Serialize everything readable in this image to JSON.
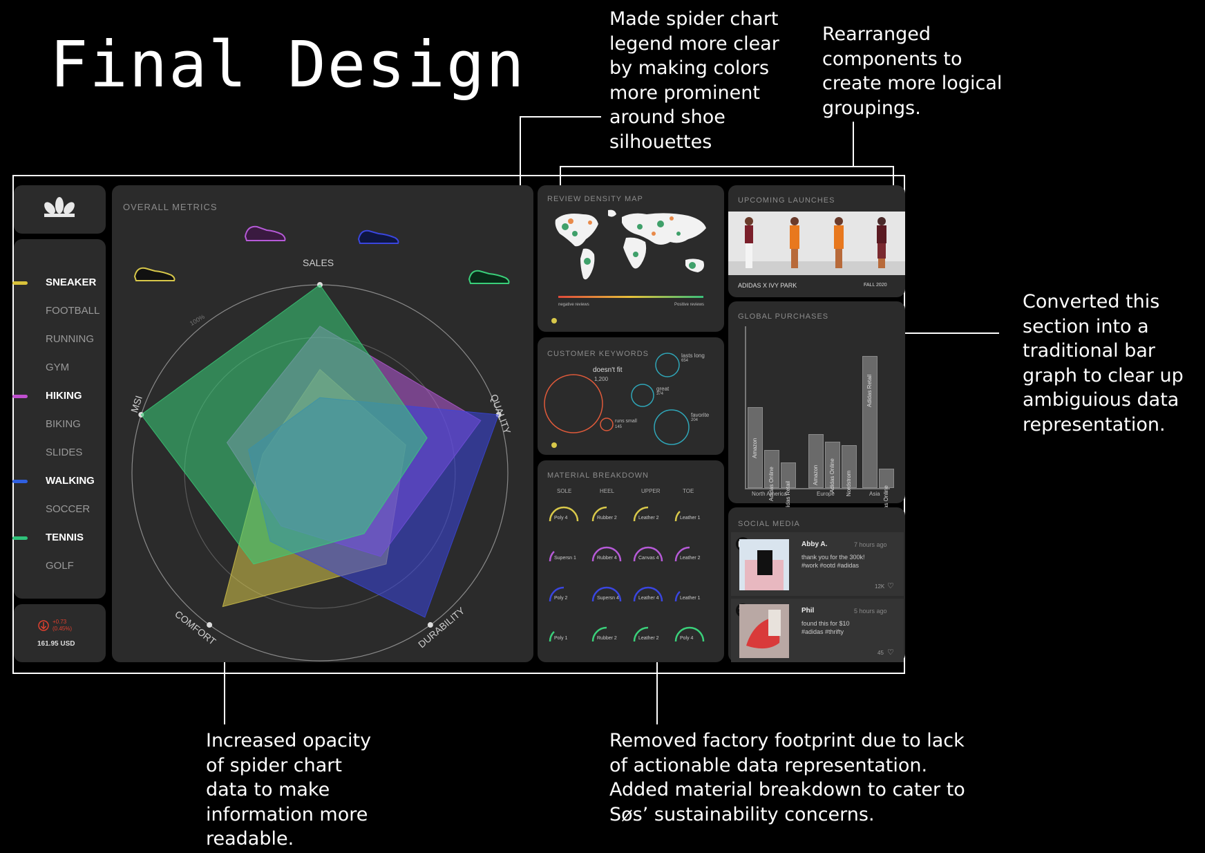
{
  "slide": {
    "title": "Final Design",
    "notes": {
      "spider_legend": "Made spider chart\nlegend more clear\nby making colors\nmore prominent\naround shoe\nsilhouettes",
      "rearranged": "Rearranged\ncomponents to\ncreate more logical\ngroupings.",
      "converted": "Converted this\nsection into a\ntraditional bar\ngraph to clear up\nambiguious data\nrepresentation.",
      "opacity": "Increased opacity\nof spider chart\ndata to make\ninformation more\nreadable.",
      "removed": "Removed factory footprint due to lack\nof actionable data representation.\nAdded material breakdown to cater to\nSøs’ sustainability concerns."
    }
  },
  "dashboard": {
    "logo_icon": "adidas-trefoil-icon",
    "sidebar": {
      "items": [
        {
          "label": "SNEAKER",
          "active": true,
          "color": "#d9c23a"
        },
        {
          "label": "FOOTBALL",
          "active": false
        },
        {
          "label": "RUNNING",
          "active": false
        },
        {
          "label": "GYM",
          "active": false
        },
        {
          "label": "HIKING",
          "active": true,
          "color": "#c04fd0"
        },
        {
          "label": "BIKING",
          "active": false
        },
        {
          "label": "SLIDES",
          "active": false
        },
        {
          "label": "WALKING",
          "active": true,
          "color": "#2f5fe0"
        },
        {
          "label": "SOCCER",
          "active": false
        },
        {
          "label": "TENNIS",
          "active": true,
          "color": "#2fc27a"
        },
        {
          "label": "GOLF",
          "active": false
        }
      ]
    },
    "stock": {
      "change": "+0.73",
      "percent": "(0.45%)",
      "price": "161.95 USD",
      "color": "#e0402f"
    },
    "overall_metrics": {
      "title": "OVERALL METRICS",
      "ring_label": "100%",
      "axes": [
        "SALES",
        "QUALITY",
        "DURABILITY",
        "COMFORT",
        "MSI"
      ]
    },
    "review_density": {
      "title": "REVIEW DENSITY MAP",
      "legend_left": "negative reviews",
      "legend_right": "Positive reviews"
    },
    "customer_keywords": {
      "title": "CUSTOMER KEYWORDS",
      "keywords": [
        {
          "label": "doesn't fit",
          "count": "1,200",
          "color": "#e05a3a"
        },
        {
          "label": "lasts long",
          "count": "654",
          "color": "#2fa6b8"
        },
        {
          "label": "great",
          "count": "374",
          "color": "#2fa6b8"
        },
        {
          "label": "runs small",
          "count": "145",
          "color": "#e05a3a"
        },
        {
          "label": "favorite",
          "count": "204",
          "color": "#2fa6b8"
        }
      ]
    },
    "material_breakdown": {
      "title": "MATERIAL BREAKDOWN",
      "columns": [
        "SOLE",
        "HEEL",
        "UPPER",
        "TOE"
      ],
      "rows": [
        [
          "Poly 4",
          "Rubber 2",
          "Leather 2",
          "Leather 1"
        ],
        [
          "Supersn 1",
          "Rubber 4",
          "Canvas 4",
          "Leather 2"
        ],
        [
          "Poly 2",
          "Supersn 4",
          "Leather 4",
          "Leather 1"
        ],
        [
          "Poly 1",
          "Rubber 2",
          "Leather 2",
          "Poly 4"
        ]
      ]
    },
    "upcoming_launches": {
      "title": "UPCOMING LAUNCHES",
      "caption": "ADIDAS X IVY PARK",
      "season": "FALL 2020"
    },
    "global_purchases": {
      "title": "GLOBAL PURCHASES"
    },
    "social_media": {
      "title": "SOCIAL MEDIA",
      "posts": [
        {
          "icon": "instagram-icon",
          "user": "Abby A.",
          "time": "7 hours ago",
          "text": "thank you for the 300k!\n#work #ootd #adidas",
          "likes": "12K"
        },
        {
          "icon": "twitter-icon",
          "user": "Phil",
          "time": "5 hours ago",
          "text": "found this for $10\n#adidas #thrifty",
          "likes": "45"
        }
      ]
    }
  },
  "chart_data": [
    {
      "type": "radar",
      "axes": [
        "SALES",
        "QUALITY",
        "DURABILITY",
        "COMFORT",
        "MSI"
      ],
      "ylim": [
        0,
        100
      ],
      "series": [
        {
          "name": "SNEAKER",
          "color": "#d8c84a",
          "values": [
            55,
            48,
            60,
            88,
            32
          ]
        },
        {
          "name": "HIKING",
          "color": "#b65ad8",
          "values": [
            78,
            90,
            55,
            35,
            52
          ]
        },
        {
          "name": "WALKING",
          "color": "#3a46e0",
          "values": [
            40,
            100,
            95,
            45,
            40
          ]
        },
        {
          "name": "TENNIS",
          "color": "#3ad07a",
          "values": [
            100,
            60,
            40,
            60,
            100
          ]
        }
      ]
    },
    {
      "type": "bar",
      "groups": [
        "North America",
        "Europe",
        "Asia"
      ],
      "categories": [
        "Amazon",
        "Adidas Online",
        "Adidas Retail",
        "Amazon",
        "Adidas Online",
        "Nordstrom",
        "Adidas Retail",
        "Adidas Online"
      ],
      "group_index": [
        0,
        0,
        0,
        1,
        1,
        1,
        2,
        2
      ],
      "values": [
        51,
        24,
        16,
        34,
        29,
        27,
        83,
        12
      ],
      "ylim": [
        0,
        100
      ]
    }
  ]
}
